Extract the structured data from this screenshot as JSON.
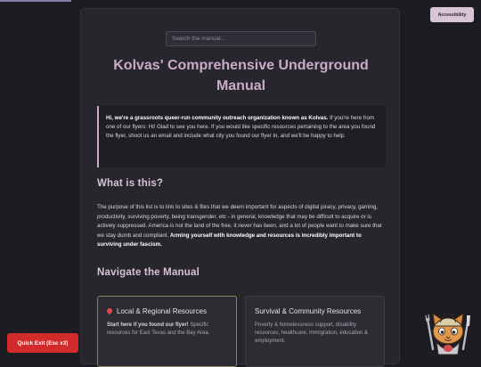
{
  "search": {
    "placeholder": "Search the manual..."
  },
  "header": {
    "title": "Kolvas' Comprehensive Underground Manual"
  },
  "intro": {
    "bold": "Hi, we're a grassroots queer-run community outreach organization known as Kolvas.",
    "text": " If you're here from one of our flyers: Hi! Glad to see you here. If you would like specific resources pertaining to the area you found the flyer, shoot us an email and include what city you found our flyer in, and we'll be happy to help."
  },
  "what": {
    "heading": "What is this?",
    "text": "The purpose of this list is to link to sites & files that we deem important for aspects of digital piracy, privacy, gaming, productivity, surviving poverty, being transgender, etc - in general, knowledge that may be difficult to acquire or is actively suppressed. America is not the land of the free, it never has been, and a lot of people want to make sure that we stay dumb and compliant. ",
    "bold": "Arming yourself with knowledge and resources is incredibly important to surviving under fascism."
  },
  "navigate": {
    "heading": "Navigate the Manual",
    "cards": [
      {
        "icon": "pin-icon",
        "title": "Local & Regional Resources",
        "desc_bold": "Start here if you found our flyer!",
        "desc": " Specific resources for East Texas and the Bay Area."
      },
      {
        "title": "Survival & Community Resources",
        "desc": "Poverty & homelessness support, disability resources, healthcare, immigration, education & employment."
      }
    ]
  },
  "accessibility": {
    "label": "Accessibility"
  },
  "quick_exit": {
    "label": "Quick Exit (Esc x3)"
  },
  "colors": {
    "background": "#1d1c22",
    "panel": "#27262d",
    "accent": "#c9abc8",
    "danger": "#d12b2b"
  }
}
